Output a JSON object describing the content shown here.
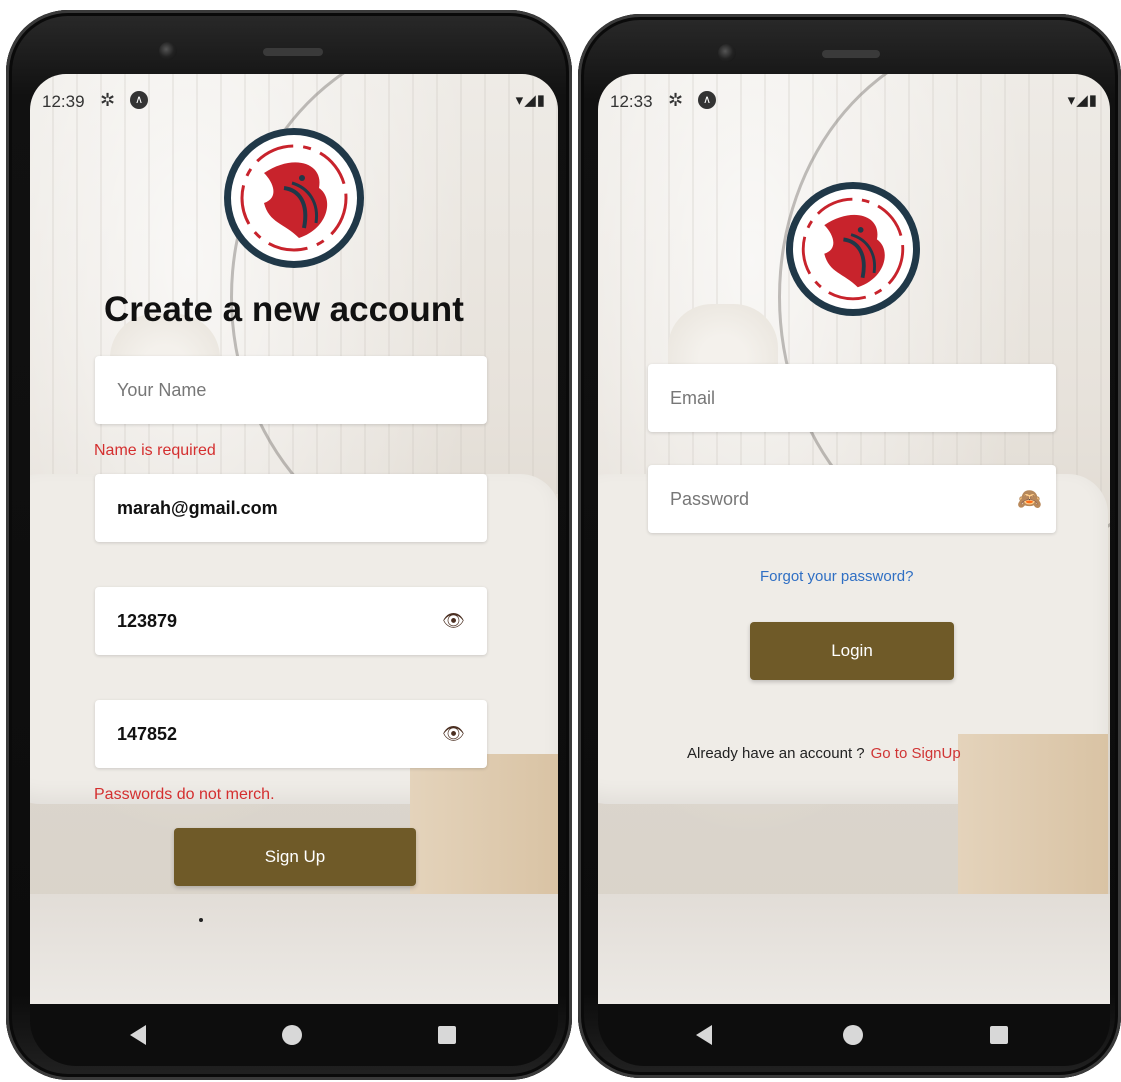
{
  "signup_screen": {
    "status": {
      "time": "12:39",
      "gear_icon": "gear-icon",
      "app_icon": "android-notification-icon",
      "right_icons": "wifi-icon signal-icon battery-icon"
    },
    "title": "Create a new account",
    "name_field": {
      "placeholder": "Your Name",
      "value": ""
    },
    "name_error": "Name is required",
    "email_field": {
      "value": "marah@gmail.com"
    },
    "password_field": {
      "value": "123879",
      "icon": "eye-icon"
    },
    "confirm_field": {
      "value": "147852",
      "icon": "eye-icon"
    },
    "password_error": "Passwords do not merch.",
    "signup_button": "Sign Up"
  },
  "login_screen": {
    "status": {
      "time": "12:33",
      "gear_icon": "gear-icon",
      "app_icon": "android-notification-icon",
      "right_icons": "wifi-icon signal-icon battery-icon"
    },
    "email_field": {
      "placeholder": "Email"
    },
    "password_field": {
      "placeholder": "Password",
      "icon": "see-no-evil-monkey-icon"
    },
    "forgot_link": "Forgot your password?",
    "login_button": "Login",
    "signup_prompt": "Already have an account ?",
    "signup_link": "Go to SignUp"
  },
  "nav": {
    "back": "back-icon",
    "home": "home-icon",
    "recents": "recents-icon"
  },
  "colors": {
    "accent_button": "#6f5a28",
    "error_red": "#d42f2f",
    "link_blue": "#2f6fc4",
    "logo_ring": "#203848",
    "logo_red": "#c8232c"
  }
}
